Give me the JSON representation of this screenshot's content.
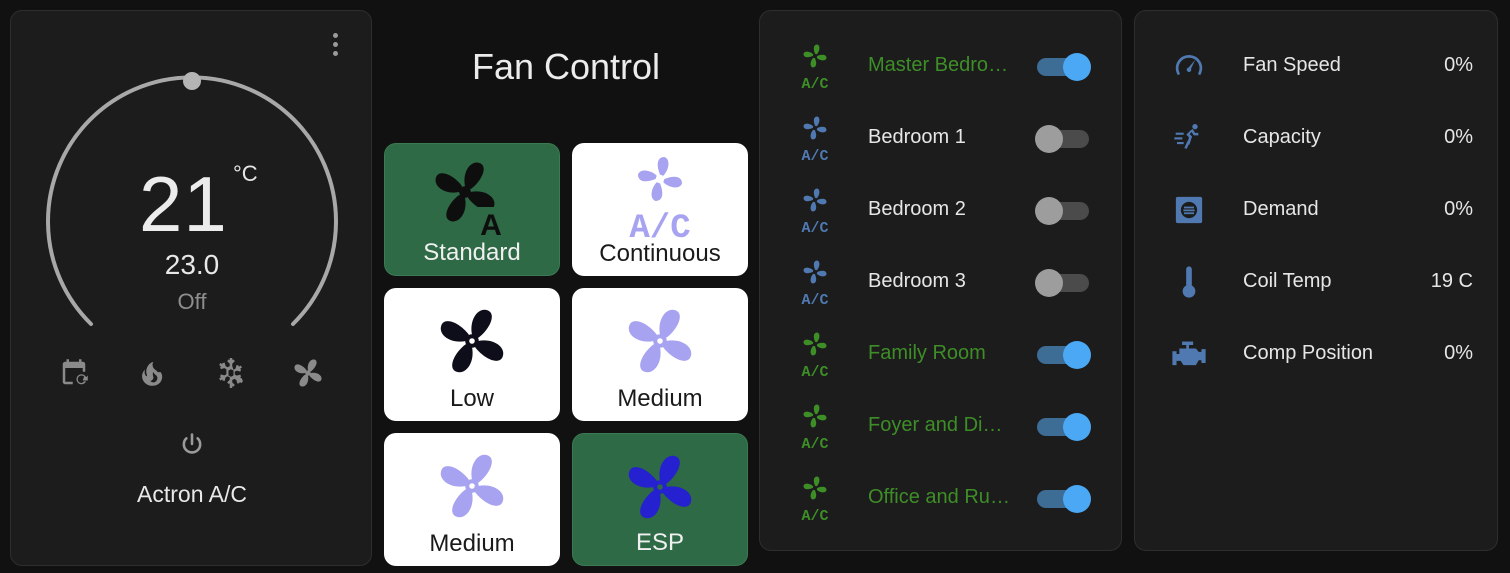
{
  "thermostat": {
    "current_temp": "21",
    "unit": "°C",
    "target_temp": "23.0",
    "state": "Off",
    "name": "Actron A/C",
    "modes": [
      "auto-schedule-icon",
      "heat-flame-icon",
      "cool-snowflake-icon",
      "fan-only-icon"
    ]
  },
  "fan_control": {
    "title": "Fan Control",
    "buttons": [
      {
        "label": "Standard",
        "icon": "fan-auto-icon",
        "active": true
      },
      {
        "label": "Continuous",
        "icon": "fan-ac-icon",
        "active": false
      },
      {
        "label": "Low",
        "icon": "fan-icon",
        "active": false
      },
      {
        "label": "Medium",
        "icon": "fan-icon",
        "active": false
      },
      {
        "label": "Medium",
        "icon": "fan-icon",
        "active": false
      },
      {
        "label": "ESP",
        "icon": "fan-icon",
        "active": true
      }
    ]
  },
  "zones": [
    {
      "name": "Master Bedroom",
      "on": true
    },
    {
      "name": "Bedroom 1",
      "on": false
    },
    {
      "name": "Bedroom 2",
      "on": false
    },
    {
      "name": "Bedroom 3",
      "on": false
    },
    {
      "name": "Family Room",
      "on": true
    },
    {
      "name": "Foyer and Dining",
      "on": true
    },
    {
      "name": "Office and Rumpus",
      "on": true
    }
  ],
  "sensors": [
    {
      "name": "Fan Speed",
      "value": "0%",
      "icon": "speedometer-icon"
    },
    {
      "name": "Capacity",
      "value": "0%",
      "icon": "run-fast-icon"
    },
    {
      "name": "Demand",
      "value": "0%",
      "icon": "hvac-demand-icon"
    },
    {
      "name": "Coil Temp",
      "value": "19 C",
      "icon": "thermometer-icon"
    },
    {
      "name": "Comp Position",
      "value": "0%",
      "icon": "engine-icon"
    }
  ],
  "colors": {
    "zone_on_text": "#3e8e28",
    "zone_icon_on": "#3e8e28",
    "zone_icon_off": "#4f79b0",
    "toggle_on": "#4aa8f4",
    "fan_active_bg": "#2d6a45",
    "sensor_icon": "#4f79b0"
  }
}
